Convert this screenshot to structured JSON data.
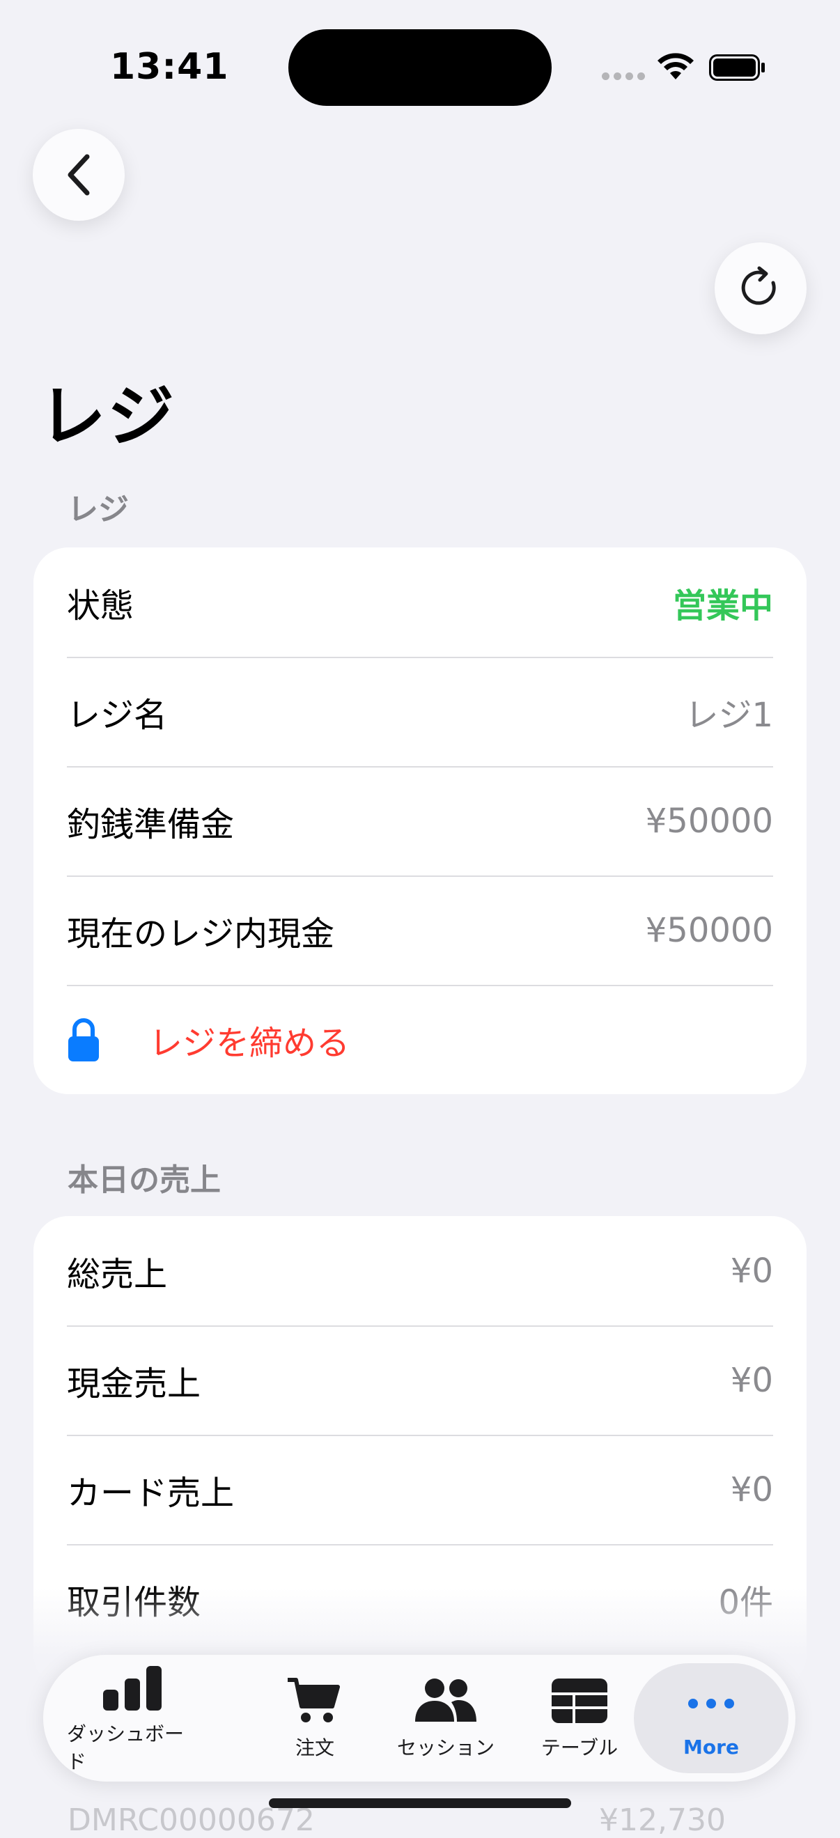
{
  "status_bar": {
    "time": "13:41"
  },
  "page": {
    "title": "レジ"
  },
  "register_section": {
    "header": "レジ",
    "rows": [
      {
        "label": "状態",
        "value": "営業中"
      },
      {
        "label": "レジ名",
        "value": "レジ1"
      },
      {
        "label": "釣銭準備金",
        "value": "¥50000"
      },
      {
        "label": "現在のレジ内現金",
        "value": "¥50000"
      }
    ],
    "close_action": "レジを締める"
  },
  "sales_section": {
    "header": "本日の売上",
    "rows": [
      {
        "label": "総売上",
        "value": "¥0"
      },
      {
        "label": "現金売上",
        "value": "¥0"
      },
      {
        "label": "カード売上",
        "value": "¥0"
      },
      {
        "label": "取引件数",
        "value": "0件"
      }
    ]
  },
  "behind_list": {
    "id": "DMRC00000672",
    "amount": "¥12,730"
  },
  "tab_bar": {
    "tabs": [
      {
        "label": "ダッシュボード",
        "icon": "bar-chart-icon"
      },
      {
        "label": "注文",
        "icon": "cart-icon"
      },
      {
        "label": "セッション",
        "icon": "people-icon"
      },
      {
        "label": "テーブル",
        "icon": "table-icon"
      },
      {
        "label": "More",
        "icon": "more-icon"
      }
    ],
    "active_index": 4
  },
  "colors": {
    "background": "#f2f2f7",
    "status_open": "#34c759",
    "destructive": "#ff3b30",
    "lock_blue": "#0a7cff",
    "active_tab": "#1a73e8"
  }
}
